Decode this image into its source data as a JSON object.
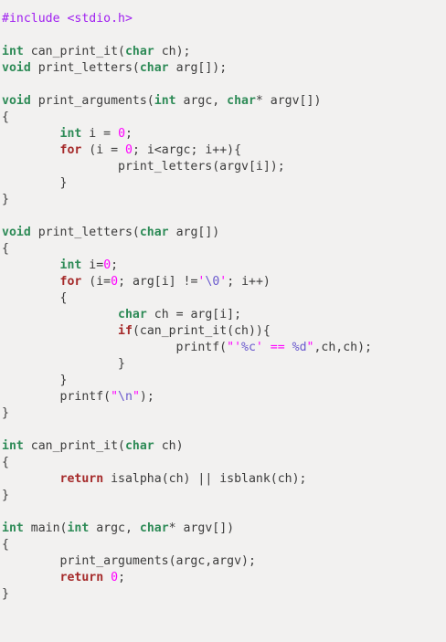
{
  "editor": {
    "lines": [
      [
        {
          "t": "pre",
          "v": "#include <stdio.h>"
        }
      ],
      [],
      [
        {
          "t": "type",
          "v": "int"
        },
        {
          "t": "plain",
          "v": " can_print_it("
        },
        {
          "t": "type",
          "v": "char"
        },
        {
          "t": "plain",
          "v": " ch);"
        }
      ],
      [
        {
          "t": "type",
          "v": "void"
        },
        {
          "t": "plain",
          "v": " print_letters("
        },
        {
          "t": "type",
          "v": "char"
        },
        {
          "t": "plain",
          "v": " arg[]);"
        }
      ],
      [],
      [
        {
          "t": "type",
          "v": "void"
        },
        {
          "t": "plain",
          "v": " print_arguments("
        },
        {
          "t": "type",
          "v": "int"
        },
        {
          "t": "plain",
          "v": " argc, "
        },
        {
          "t": "type",
          "v": "char"
        },
        {
          "t": "plain",
          "v": "* argv[])"
        }
      ],
      [
        {
          "t": "plain",
          "v": "{"
        }
      ],
      [
        {
          "t": "plain",
          "v": "        "
        },
        {
          "t": "type",
          "v": "int"
        },
        {
          "t": "plain",
          "v": " i = "
        },
        {
          "t": "num",
          "v": "0"
        },
        {
          "t": "plain",
          "v": ";"
        }
      ],
      [
        {
          "t": "plain",
          "v": "        "
        },
        {
          "t": "kw",
          "v": "for"
        },
        {
          "t": "plain",
          "v": " (i = "
        },
        {
          "t": "num",
          "v": "0"
        },
        {
          "t": "plain",
          "v": "; i<argc; i++){"
        }
      ],
      [
        {
          "t": "plain",
          "v": "                print_letters(argv[i]);"
        }
      ],
      [
        {
          "t": "plain",
          "v": "        }"
        }
      ],
      [
        {
          "t": "plain",
          "v": "}"
        }
      ],
      [],
      [
        {
          "t": "type",
          "v": "void"
        },
        {
          "t": "plain",
          "v": " print_letters("
        },
        {
          "t": "type",
          "v": "char"
        },
        {
          "t": "plain",
          "v": " arg[])"
        }
      ],
      [
        {
          "t": "plain",
          "v": "{"
        }
      ],
      [
        {
          "t": "plain",
          "v": "        "
        },
        {
          "t": "type",
          "v": "int"
        },
        {
          "t": "plain",
          "v": " i="
        },
        {
          "t": "num",
          "v": "0"
        },
        {
          "t": "plain",
          "v": ";"
        }
      ],
      [
        {
          "t": "plain",
          "v": "        "
        },
        {
          "t": "kw",
          "v": "for"
        },
        {
          "t": "plain",
          "v": " (i="
        },
        {
          "t": "num",
          "v": "0"
        },
        {
          "t": "plain",
          "v": "; arg[i] !="
        },
        {
          "t": "str",
          "v": "'"
        },
        {
          "t": "esc",
          "v": "\\0"
        },
        {
          "t": "str",
          "v": "'"
        },
        {
          "t": "plain",
          "v": "; i++)"
        }
      ],
      [
        {
          "t": "plain",
          "v": "        {"
        }
      ],
      [
        {
          "t": "plain",
          "v": "                "
        },
        {
          "t": "type",
          "v": "char"
        },
        {
          "t": "plain",
          "v": " ch = arg[i];"
        }
      ],
      [
        {
          "t": "plain",
          "v": "                "
        },
        {
          "t": "kw",
          "v": "if"
        },
        {
          "t": "plain",
          "v": "(can_print_it(ch)){"
        }
      ],
      [
        {
          "t": "plain",
          "v": "                        printf("
        },
        {
          "t": "str",
          "v": "\"'"
        },
        {
          "t": "esc",
          "v": "%c"
        },
        {
          "t": "str",
          "v": "' == "
        },
        {
          "t": "esc",
          "v": "%d"
        },
        {
          "t": "str",
          "v": "\""
        },
        {
          "t": "plain",
          "v": ",ch,ch);"
        }
      ],
      [
        {
          "t": "plain",
          "v": "                }"
        }
      ],
      [
        {
          "t": "plain",
          "v": "        }"
        }
      ],
      [
        {
          "t": "plain",
          "v": "        printf("
        },
        {
          "t": "str",
          "v": "\""
        },
        {
          "t": "esc",
          "v": "\\n"
        },
        {
          "t": "str",
          "v": "\""
        },
        {
          "t": "plain",
          "v": ");"
        }
      ],
      [
        {
          "t": "plain",
          "v": "}"
        }
      ],
      [],
      [
        {
          "t": "type",
          "v": "int"
        },
        {
          "t": "plain",
          "v": " can_print_it("
        },
        {
          "t": "type",
          "v": "char"
        },
        {
          "t": "plain",
          "v": " ch)"
        }
      ],
      [
        {
          "t": "plain",
          "v": "{"
        }
      ],
      [
        {
          "t": "plain",
          "v": "        "
        },
        {
          "t": "kw",
          "v": "return"
        },
        {
          "t": "plain",
          "v": " isalpha(ch) || isblank(ch);"
        }
      ],
      [
        {
          "t": "plain",
          "v": "}"
        }
      ],
      [],
      [
        {
          "t": "type",
          "v": "int"
        },
        {
          "t": "plain",
          "v": " main("
        },
        {
          "t": "type",
          "v": "int"
        },
        {
          "t": "plain",
          "v": " argc, "
        },
        {
          "t": "type",
          "v": "char"
        },
        {
          "t": "plain",
          "v": "* argv[])"
        }
      ],
      [
        {
          "t": "plain",
          "v": "{"
        }
      ],
      [
        {
          "t": "plain",
          "v": "        print_arguments(argc,argv);"
        }
      ],
      [
        {
          "t": "plain",
          "v": "        "
        },
        {
          "t": "kw",
          "v": "return"
        },
        {
          "t": "plain",
          "v": " "
        },
        {
          "t": "num",
          "v": "0"
        },
        {
          "t": "plain",
          "v": ";"
        }
      ],
      [
        {
          "t": "plain",
          "v": "}"
        }
      ]
    ]
  }
}
